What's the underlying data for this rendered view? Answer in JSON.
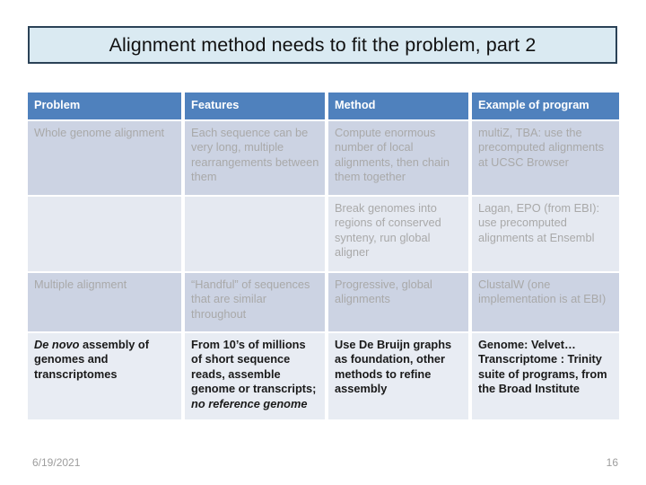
{
  "slide": {
    "title": "Alignment method needs to fit the problem, part 2",
    "accent_header_color": "#4f81bd",
    "title_fill_color": "#daeaf2",
    "title_border_color": "#2b4257"
  },
  "table": {
    "headers": [
      "Problem",
      "Features",
      "Method",
      "Example of program"
    ],
    "rows": [
      {
        "style": "faded",
        "problem": "Whole genome alignment",
        "features": "Each sequence can be very long, multiple rearrangements between them",
        "method": "Compute enormous number of local alignments, then chain them together",
        "example": "multiZ, TBA: use the precomputed alignments at UCSC Browser"
      },
      {
        "style": "faded",
        "problem": "",
        "features": "",
        "method": "Break genomes into regions of conserved synteny, run global aligner",
        "example": "Lagan, EPO (from EBI): use precomputed alignments at Ensembl"
      },
      {
        "style": "faded",
        "problem": "Multiple alignment",
        "features": "“Handful” of sequences that are similar throughout",
        "method": "Progressive, global alignments",
        "example": "ClustalW (one implementation is at EBI)"
      },
      {
        "style": "strong",
        "problem_italic": "De novo",
        "problem_rest": " assembly of genomes and transcriptomes",
        "features_main": "From 10’s of millions of short sequence reads, assemble genome or transcripts; ",
        "features_italic": "no reference genome",
        "method": "Use De Bruijn graphs as foundation, other methods to refine assembly",
        "example": "Genome: Velvet…Transcriptome : Trinity suite of programs, from the Broad Institute"
      }
    ]
  },
  "footer": {
    "date": "6/19/2021",
    "page_number": "16"
  }
}
